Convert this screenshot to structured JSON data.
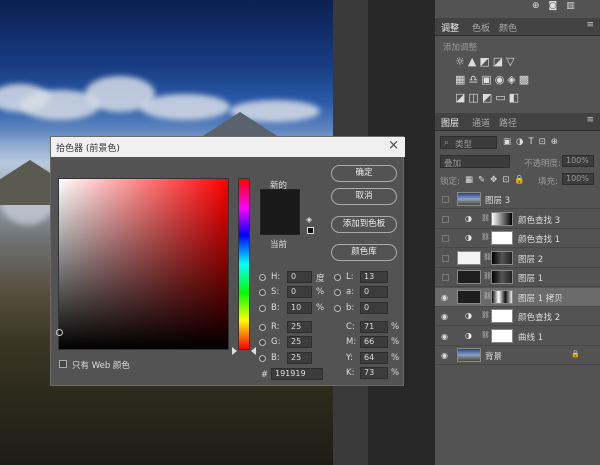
{
  "photo": {
    "description_icon": "landscape-photo"
  },
  "top_icons": [
    "quick-action-icon",
    "camera-icon",
    "trash-icon"
  ],
  "adjust_panel": {
    "tabs": [
      "调整",
      "色板",
      "颜色"
    ],
    "subtitle": "添加调整"
  },
  "layers_panel": {
    "tabs": [
      "图层",
      "通道",
      "路径"
    ],
    "search_placeholder": "类型",
    "blend_mode": "叠加",
    "opacity_label": "不透明度:",
    "opacity_value": "100%",
    "lock_label": "锁定:",
    "fill_label": "填充:",
    "fill_value": "100%",
    "layers": [
      {
        "name": "图层 3",
        "visible": false,
        "kind": "photo"
      },
      {
        "name": "颜色查找 3",
        "visible": false,
        "kind": "adjust"
      },
      {
        "name": "颜色查找 1",
        "visible": false,
        "kind": "adjust"
      },
      {
        "name": "图层 2",
        "visible": false,
        "kind": "mask"
      },
      {
        "name": "图层 1",
        "visible": false,
        "kind": "mask"
      },
      {
        "name": "图层 1 拷贝",
        "visible": true,
        "kind": "mask",
        "selected": true
      },
      {
        "name": "颜色查找 2",
        "visible": true,
        "kind": "adjust"
      },
      {
        "name": "曲线 1",
        "visible": true,
        "kind": "adjust"
      },
      {
        "name": "背景",
        "visible": true,
        "kind": "photo",
        "locked": true
      }
    ]
  },
  "color_picker": {
    "title": "拾色器 (前景色)",
    "new_label": "新的",
    "current_label": "当前",
    "buttons": {
      "ok": "确定",
      "cancel": "取消",
      "add_swatch": "添加到色板",
      "library": "颜色库"
    },
    "web_only_label": "只有 Web 颜色",
    "fields": {
      "H": {
        "label": "H:",
        "value": "0",
        "unit": "度"
      },
      "S": {
        "label": "S:",
        "value": "0",
        "unit": "%"
      },
      "B": {
        "label": "B:",
        "value": "10",
        "unit": "%"
      },
      "R": {
        "label": "R:",
        "value": "25"
      },
      "G": {
        "label": "G:",
        "value": "25"
      },
      "Bl": {
        "label": "B:",
        "value": "25"
      },
      "L": {
        "label": "L:",
        "value": "13"
      },
      "a": {
        "label": "a:",
        "value": "0"
      },
      "b": {
        "label": "b:",
        "value": "0"
      },
      "C": {
        "label": "C:",
        "value": "71",
        "unit": "%"
      },
      "M": {
        "label": "M:",
        "value": "66",
        "unit": "%"
      },
      "Y": {
        "label": "Y:",
        "value": "64",
        "unit": "%"
      },
      "K": {
        "label": "K:",
        "value": "73",
        "unit": "%"
      }
    },
    "hex_label": "#",
    "hex_value": "191919",
    "current_color": "#191919"
  }
}
